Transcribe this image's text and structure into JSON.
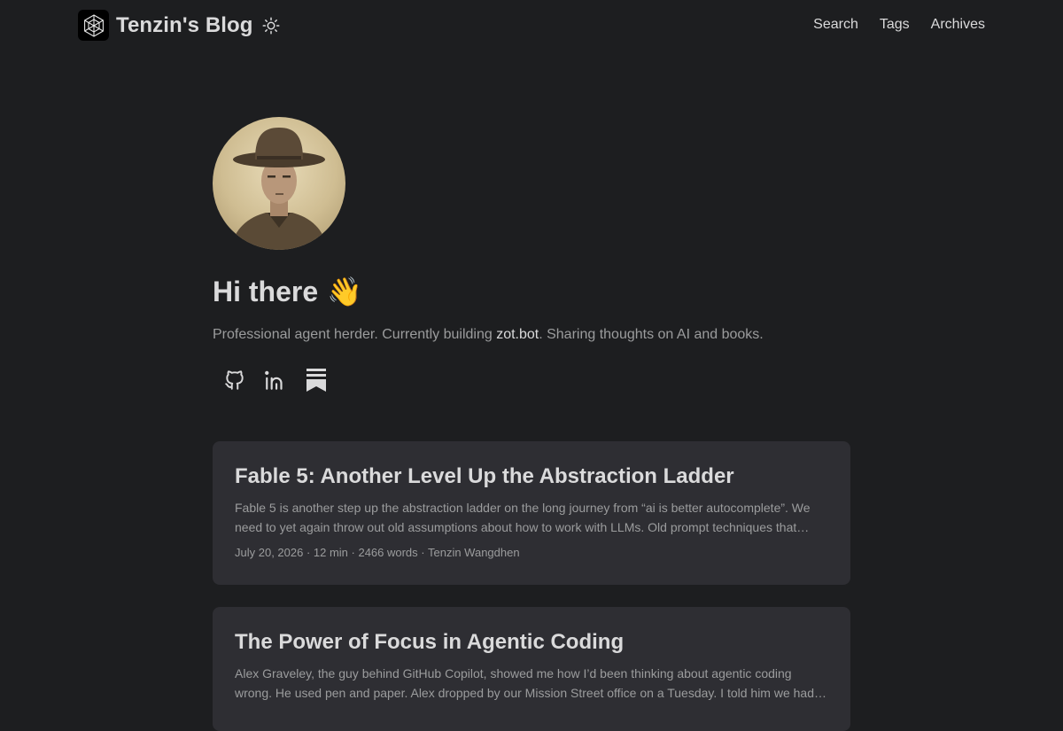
{
  "header": {
    "site_title": "Tenzin's Blog",
    "logo_icon": "cube-web-icon",
    "theme_toggle_icon": "sun-icon",
    "nav": [
      {
        "label": "Search"
      },
      {
        "label": "Tags"
      },
      {
        "label": "Archives"
      }
    ]
  },
  "profile": {
    "greeting": "Hi there",
    "greeting_emoji": "👋",
    "bio_prefix": "Professional agent herder. Currently building ",
    "bio_link": "zot.bot",
    "bio_suffix": ". Sharing thoughts on AI and books.",
    "socials": [
      {
        "icon": "github-icon"
      },
      {
        "icon": "linkedin-icon"
      },
      {
        "icon": "substack-icon"
      }
    ]
  },
  "posts": [
    {
      "title": "Fable 5: Another Level Up the Abstraction Ladder",
      "excerpt": "Fable 5 is another step up the abstraction ladder on the long journey from “ai is better autocomplete”. We need to yet again throw out old assumptions about how to work with LLMs. Old prompt techniques that…",
      "meta": "July 20, 2026 · 12 min · 2466 words · Tenzin Wangdhen"
    },
    {
      "title": "The Power of Focus in Agentic Coding",
      "excerpt": "Alex Graveley, the guy behind GitHub Copilot, showed me how I’d been thinking about agentic coding wrong. He used pen and paper. Alex dropped by our Mission Street office on a Tuesday. I told him we had…",
      "meta": ""
    }
  ],
  "colors": {
    "background": "#1d1e20",
    "card": "#2e2e33",
    "primary_text": "#dadadb",
    "secondary_text": "#9b9c9d"
  }
}
